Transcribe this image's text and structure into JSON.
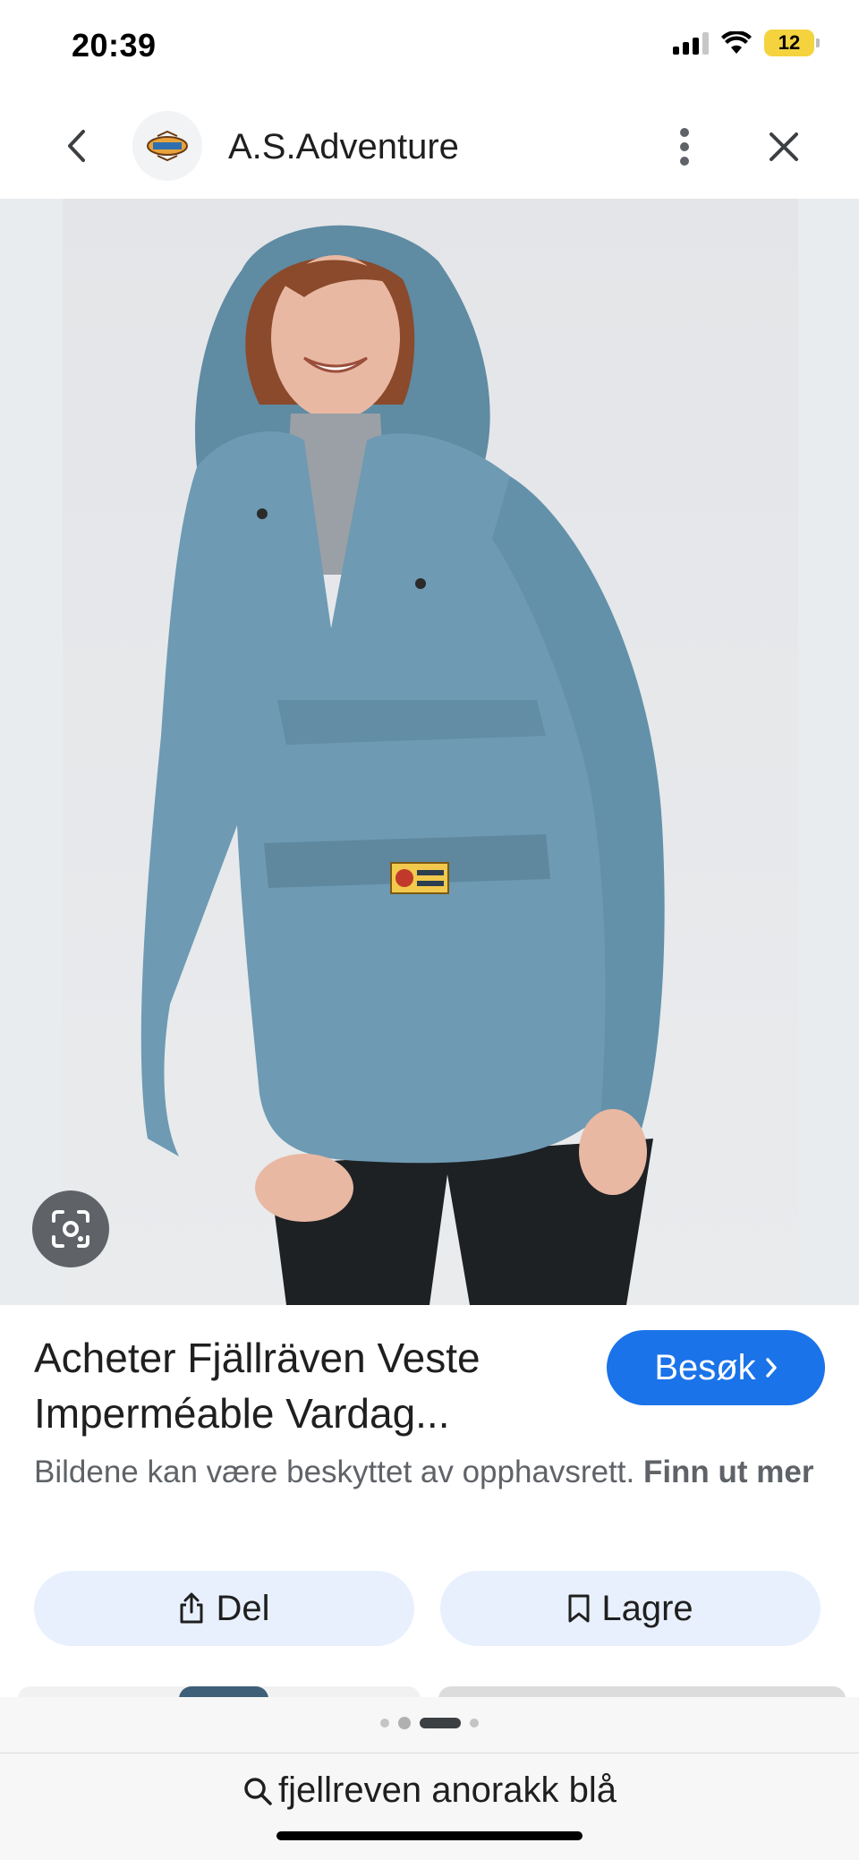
{
  "status_bar": {
    "time": "20:39",
    "battery": "12"
  },
  "header": {
    "site_name": "A.S.Adventure",
    "icons": [
      "chevron-left-icon",
      "site-logo",
      "more-vert-icon",
      "close-icon"
    ]
  },
  "image": {
    "lens_icon": "google-lens-icon",
    "colors": {
      "jacket": "#6e9ab3",
      "pants": "#1d2124",
      "shirt": "#9aa0a5",
      "hair": "#8a4a2b",
      "skin": "#e9b8a2",
      "background": "#e5e7ea"
    }
  },
  "result": {
    "title": "Acheter Fjällräven Veste Imperméable Vardag...",
    "visit_label": "Besøk",
    "copyright_text": "Bildene kan være beskyttet av opphavsrett. ",
    "copyright_link": "Finn ut mer"
  },
  "actions": {
    "share_label": "Del",
    "save_label": "Lagre"
  },
  "bottom": {
    "query": "fjellreven anorakk blå"
  },
  "colors": {
    "accent": "#1a73e8",
    "action_bg": "#e8f0fe"
  }
}
